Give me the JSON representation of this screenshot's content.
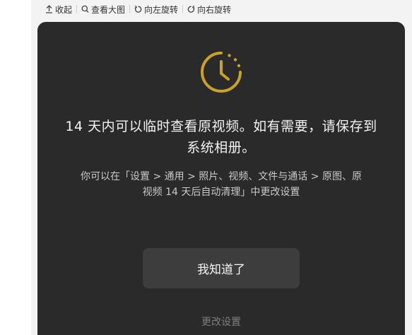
{
  "toolbar": {
    "collapse_label": "收起",
    "view_large_label": "查看大图",
    "rotate_left_label": "向左旋转",
    "rotate_right_label": "向右旋转"
  },
  "dialog": {
    "headline_line1": "14 天内可以临时查看原视频。如有需要，请保存到",
    "headline_line2": "系统相册。",
    "description_line1": "你可以在「设置 > 通用 > 照片、视频、文件与通话 > 原图、原",
    "description_line2": "视频 14 天后自动清理」中更改设置",
    "confirm_label": "我知道了",
    "change_settings_label": "更改设置",
    "clock_icon": "clock-icon"
  },
  "colors": {
    "card_background": "#2a2a2a",
    "accent_gold": "#c9a227"
  }
}
